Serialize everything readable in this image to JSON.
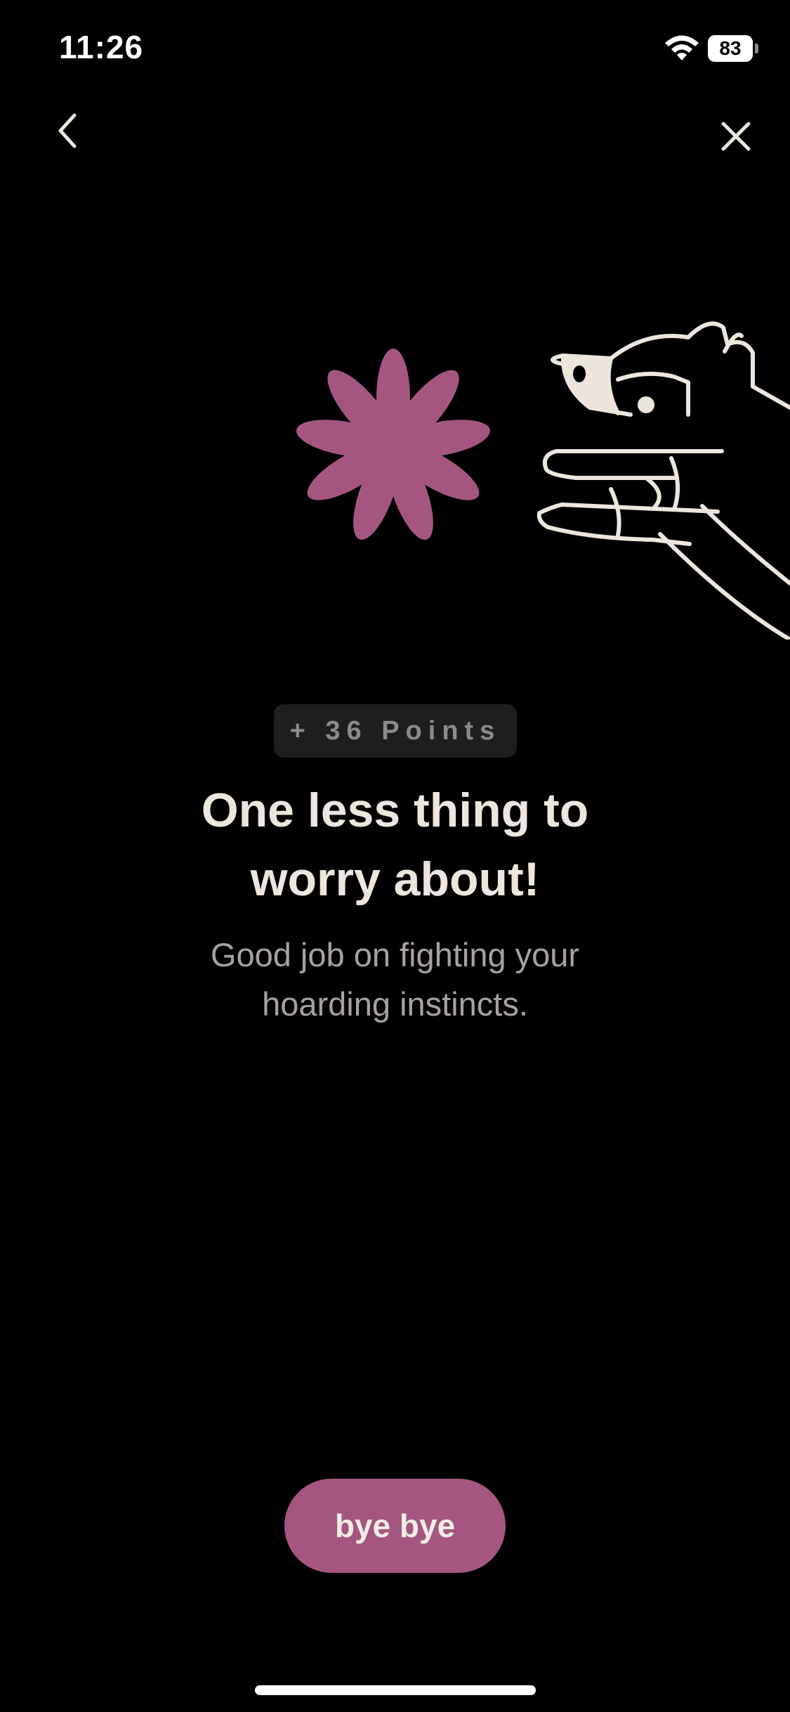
{
  "status_bar": {
    "time": "11:26",
    "battery_level": "83",
    "icons": [
      "wifi-icon",
      "battery-icon"
    ]
  },
  "nav": {
    "back_icon": "chevron-left-icon",
    "close_icon": "close-icon"
  },
  "illustration": {
    "icons": [
      "flower-icon",
      "raccoon-icon",
      "hand-icon"
    ]
  },
  "reward": {
    "points_label": "+ 36 Points"
  },
  "message": {
    "headline_line1": "One less thing to",
    "headline_line2": "worry about!",
    "subtext_line1": "Good job on fighting your",
    "subtext_line2": "hoarding instincts."
  },
  "action": {
    "button_label": "bye bye"
  },
  "colors": {
    "background": "#000000",
    "accent": "#A45680",
    "text_primary": "#ECE6DD",
    "text_secondary": "#A8A29C",
    "badge_bg": "#1E1E1E"
  }
}
